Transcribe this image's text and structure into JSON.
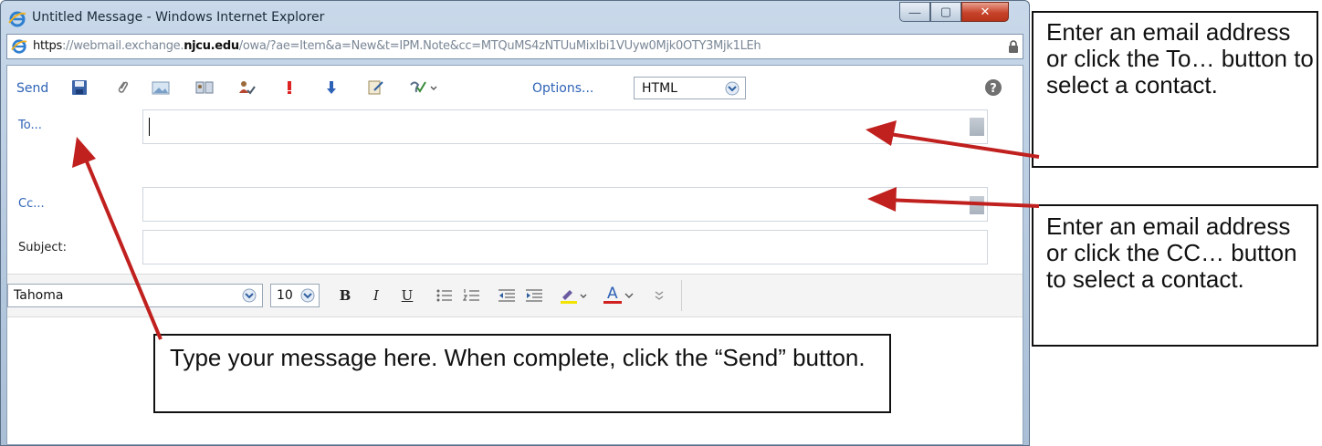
{
  "window": {
    "title": "Untitled Message - Windows Internet Explorer",
    "controls": {
      "minimize": "—",
      "maximize": "▢",
      "close": "✕"
    }
  },
  "address_bar": {
    "scheme": "https",
    "pre_host": "://webmail.exchange.",
    "host_bold": "njcu.edu",
    "path": "/owa/?ae=Item&a=New&t=IPM.Note&cc=MTQuMS4zNTUuMixlbi1VUyw0Mjk0OTY3Mjk1LEh",
    "lock_icon": "lock-icon"
  },
  "toolbar": {
    "send_label": "Send",
    "options_label": "Options...",
    "format_value": "HTML",
    "icons": [
      "save-icon",
      "attach-icon",
      "insert-image-icon",
      "address-book-icon",
      "check-names-icon",
      "high-importance-icon",
      "low-importance-icon",
      "signature-icon",
      "spell-check-icon"
    ],
    "help_icon": "help-icon"
  },
  "compose": {
    "to_label": "To...",
    "cc_label": "Cc...",
    "subject_label": "Subject:",
    "to_value": "",
    "cc_value": "",
    "subject_value": ""
  },
  "format_bar": {
    "font": "Tahoma",
    "size": "10",
    "bold": "B",
    "italic": "I",
    "underline": "U",
    "text_color_label": "A"
  },
  "callouts": {
    "to_help": "Enter an email address or click the To… button to select a contact.",
    "cc_help": "Enter an email address or click the CC… button to select a contact.",
    "body_help": "Type your message here. When complete, click the “Send” button."
  },
  "colors": {
    "link": "#2e62b6",
    "arrow": "#c0201e",
    "window_frame": "#b4c8de"
  }
}
